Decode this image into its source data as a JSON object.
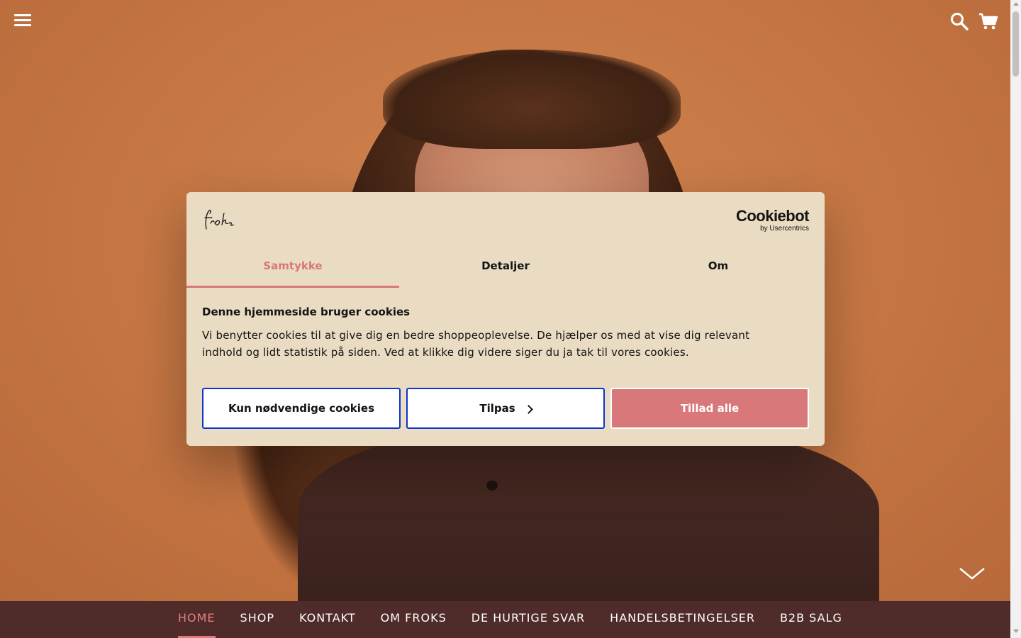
{
  "header": {
    "menu_icon": "hamburger-menu-icon",
    "search_icon": "search-icon",
    "cart_icon": "shopping-cart-icon",
    "scroll_icon": "chevron-down-icon"
  },
  "cookie_dialog": {
    "brand_logo_text": "froks",
    "provider_name": "Cookiebot",
    "provider_by": "by Usercentrics",
    "tabs": [
      {
        "label": "Samtykke",
        "active": true
      },
      {
        "label": "Detaljer",
        "active": false
      },
      {
        "label": "Om",
        "active": false
      }
    ],
    "heading": "Denne hjemmeside bruger cookies",
    "body": "Vi benytter cookies til at give dig en bedre shoppeoplevelse. De hjælper os med at vise dig relevant indhold og lidt statistik på siden. Ved at klikke dig videre siger du ja tak til vores cookies.",
    "buttons": {
      "necessary": "Kun nødvendige cookies",
      "customize": "Tilpas",
      "allow_all": "Tillad alle"
    }
  },
  "nav": {
    "items": [
      {
        "label": "HOME",
        "active": true
      },
      {
        "label": "SHOP",
        "active": false
      },
      {
        "label": "KONTAKT",
        "active": false
      },
      {
        "label": "OM FROKS",
        "active": false
      },
      {
        "label": "DE HURTIGE SVAR",
        "active": false
      },
      {
        "label": "HANDELSBETINGELSER",
        "active": false
      },
      {
        "label": "B2B SALG",
        "active": false
      }
    ]
  },
  "colors": {
    "accent": "#d8787b",
    "dialog_bg": "#eadbc3",
    "nav_bg": "#4f2c2a",
    "button_border": "#1032cf"
  }
}
